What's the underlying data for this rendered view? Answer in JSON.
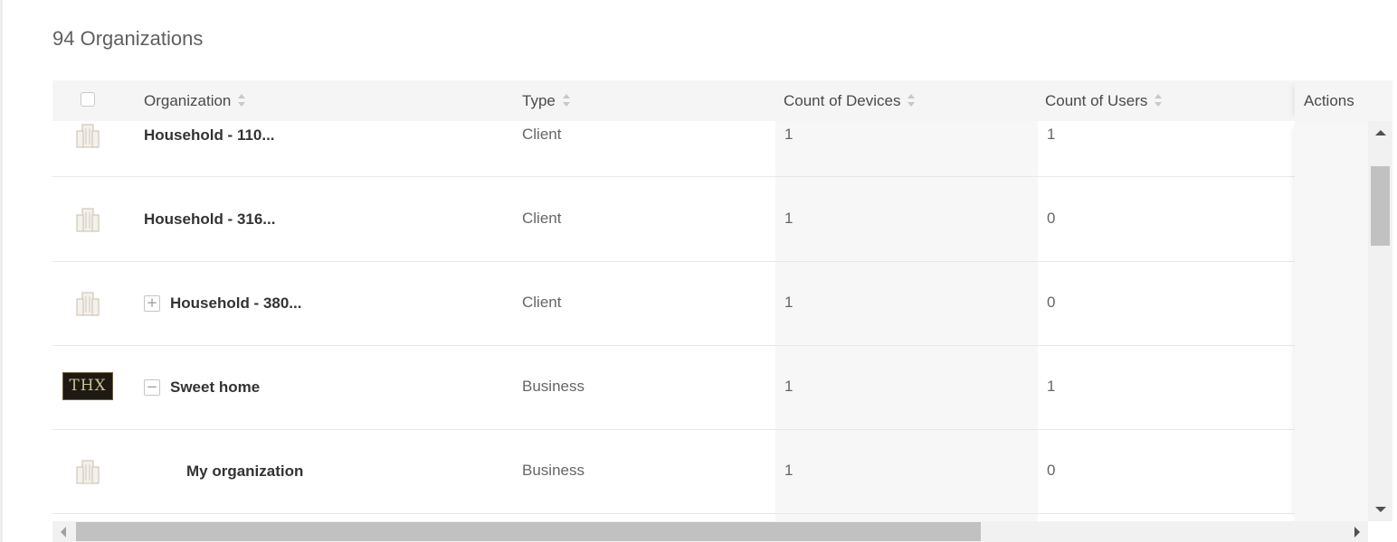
{
  "page": {
    "title": "94 Organizations"
  },
  "table": {
    "columns": [
      {
        "key": "organization",
        "label": "Organization"
      },
      {
        "key": "type",
        "label": "Type"
      },
      {
        "key": "devices",
        "label": "Count of Devices"
      },
      {
        "key": "users",
        "label": "Count of Users"
      },
      {
        "key": "actions",
        "label": "Actions"
      }
    ],
    "rows": [
      {
        "icon": "building-icon",
        "toggle": "none",
        "name": "Household - 110...",
        "type": "Client",
        "devices": "1",
        "users": "1"
      },
      {
        "icon": "building-icon",
        "toggle": "none",
        "name": "Household - 316...",
        "type": "Client",
        "devices": "1",
        "users": "0"
      },
      {
        "icon": "building-icon",
        "toggle": "expand",
        "name": "Household - 380...",
        "type": "Client",
        "devices": "1",
        "users": "0"
      },
      {
        "icon": "thx-logo",
        "logo_text": "THX",
        "toggle": "collapse",
        "name": "Sweet home",
        "type": "Business",
        "devices": "1",
        "users": "1"
      },
      {
        "icon": "building-icon",
        "toggle": "none",
        "name": "My organization",
        "type": "Business",
        "devices": "1",
        "users": "0"
      }
    ]
  },
  "colors": {
    "header_bg": "#f5f5f5",
    "column_shade": "#f7f7f7",
    "row_border": "#e8e8e8",
    "scrollbar_thumb": "#c1c1c1"
  }
}
